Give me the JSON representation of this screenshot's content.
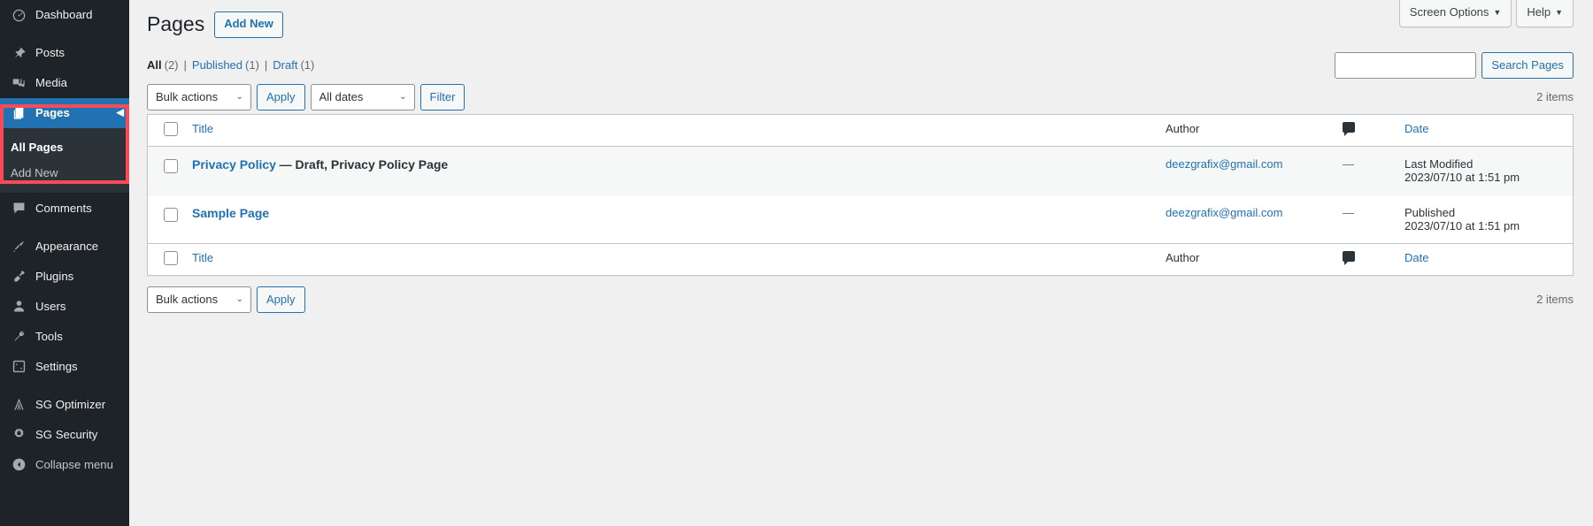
{
  "sidebar": {
    "items": [
      {
        "label": "Dashboard",
        "icon": "dashboard-icon",
        "name": "sidebar-item-dashboard",
        "gap_after": true
      },
      {
        "label": "Posts",
        "icon": "pin-icon",
        "name": "sidebar-item-posts"
      },
      {
        "label": "Media",
        "icon": "media-icon",
        "name": "sidebar-item-media"
      },
      {
        "label": "Pages",
        "icon": "pages-icon",
        "name": "sidebar-item-pages",
        "current": true
      },
      {
        "label": "Comments",
        "icon": "comment-icon",
        "name": "sidebar-item-comments",
        "gap_after": true
      },
      {
        "label": "Appearance",
        "icon": "brush-icon",
        "name": "sidebar-item-appearance"
      },
      {
        "label": "Plugins",
        "icon": "plugin-icon",
        "name": "sidebar-item-plugins"
      },
      {
        "label": "Users",
        "icon": "user-icon",
        "name": "sidebar-item-users"
      },
      {
        "label": "Tools",
        "icon": "wrench-icon",
        "name": "sidebar-item-tools"
      },
      {
        "label": "Settings",
        "icon": "sliders-icon",
        "name": "sidebar-item-settings",
        "gap_after": true
      },
      {
        "label": "SG Optimizer",
        "icon": "sg-optimizer-icon",
        "name": "sidebar-item-sg-optimizer"
      },
      {
        "label": "SG Security",
        "icon": "sg-security-icon",
        "name": "sidebar-item-sg-security"
      }
    ],
    "submenu": [
      {
        "label": "All Pages",
        "current": true
      },
      {
        "label": "Add New",
        "current": false
      }
    ],
    "collapse": {
      "label": "Collapse menu",
      "icon": "collapse-left-icon"
    },
    "highlight_color": "#f94a57"
  },
  "header": {
    "screen_options_label": "Screen Options",
    "help_label": "Help",
    "caret": "▼"
  },
  "page": {
    "title": "Pages",
    "add_new_label": "Add New"
  },
  "filters": {
    "all_label": "All",
    "all_count": "(2)",
    "published_label": "Published",
    "published_count": "(1)",
    "draft_label": "Draft",
    "draft_count": "(1)",
    "separator": "|"
  },
  "search": {
    "value": "",
    "placeholder": "",
    "button_label": "Search Pages"
  },
  "tablenav_top": {
    "bulk_actions_selected": "Bulk actions",
    "bulk_actions_options": [
      "Bulk actions",
      "Edit",
      "Move to Trash"
    ],
    "apply_label": "Apply",
    "dates_selected": "All dates",
    "dates_options": [
      "All dates",
      "July 2023"
    ],
    "filter_label": "Filter",
    "items_count": "2 items"
  },
  "tablenav_bottom": {
    "bulk_actions_selected": "Bulk actions",
    "bulk_actions_options": [
      "Bulk actions",
      "Edit",
      "Move to Trash"
    ],
    "apply_label": "Apply",
    "items_count": "2 items"
  },
  "table": {
    "columns": {
      "title": "Title",
      "author": "Author",
      "comments": "comment-icon",
      "date": "Date"
    },
    "rows": [
      {
        "title": "Privacy Policy",
        "state": "— Draft, Privacy Policy Page",
        "author": "deezgrafix@gmail.com",
        "comments": "—",
        "date_status": "Last Modified",
        "date_value": "2023/07/10 at 1:51 pm"
      },
      {
        "title": "Sample Page",
        "state": "",
        "author": "deezgrafix@gmail.com",
        "comments": "—",
        "date_status": "Published",
        "date_value": "2023/07/10 at 1:51 pm"
      }
    ]
  }
}
